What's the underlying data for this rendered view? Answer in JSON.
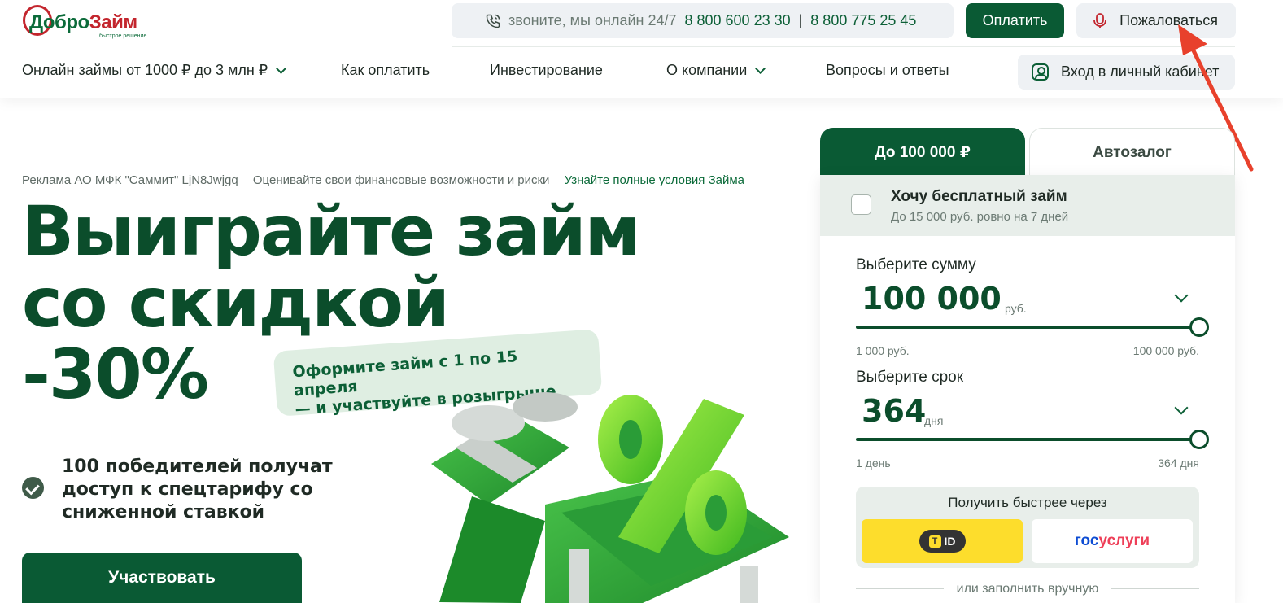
{
  "header": {
    "logo": {
      "part1": "Добро",
      "part2": "Займ",
      "tagline": "быстрое решение"
    },
    "phone": {
      "call_text": "звоните, мы онлайн 24/7",
      "number1": "8 800 600 23 30",
      "separator": "|",
      "number2": "8 800 775 25 45"
    },
    "pay_label": "Оплатить",
    "complain_label": "Пожаловаться",
    "nav": {
      "loans": "Онлайн займы от 1000 ₽ до 3 млн ₽",
      "how_to_pay": "Как оплатить",
      "investing": "Инвестирование",
      "about": "О компании",
      "faq": "Вопросы и ответы"
    },
    "login_label": "Вход в личный кабинет"
  },
  "hero": {
    "ad_notice": "Реклама АО МФК \"Саммит\" LjN8Jwjgq",
    "risk_notice": "Оценивайте свои финансовые возможности и риски",
    "terms_link": "Узнайте полные условия Займа",
    "title_line1": "Выиграйте займ",
    "title_line2": "со скидкой",
    "title_line3": "-30%",
    "promo_line1": "Оформите займ с 1 по 15 апреля",
    "promo_line2": "— и участвуйте в розыгрыше",
    "bullet": "100 победителей получат доступ к спецтарифу со сниженной ставкой",
    "cta_label": "Участвовать"
  },
  "calculator": {
    "tab_active": "До 100 000 ₽",
    "tab_inactive": "Автозалог",
    "free_loan_title": "Хочу бесплатный займ",
    "free_loan_sub": "До 15 000 руб. ровно на 7 дней",
    "amount": {
      "label": "Выберите сумму",
      "value": "100 000",
      "unit": "руб.",
      "min": "1 000 руб.",
      "max": "100 000 руб.",
      "slider_fraction": 1.0
    },
    "term": {
      "label": "Выберите срок",
      "value": "364",
      "unit": "дня",
      "min": "1 день",
      "max": "364 дня",
      "slider_fraction": 1.0
    },
    "fast_title": "Получить быстрее через",
    "tid_label": "ID",
    "gos_part1": "гос",
    "gos_part2": "услуги",
    "manual_label": "или заполнить вручную"
  },
  "colors": {
    "brand_green": "#0a5a34",
    "brand_red": "#c3252d",
    "annotation_arrow": "#e8412c"
  }
}
